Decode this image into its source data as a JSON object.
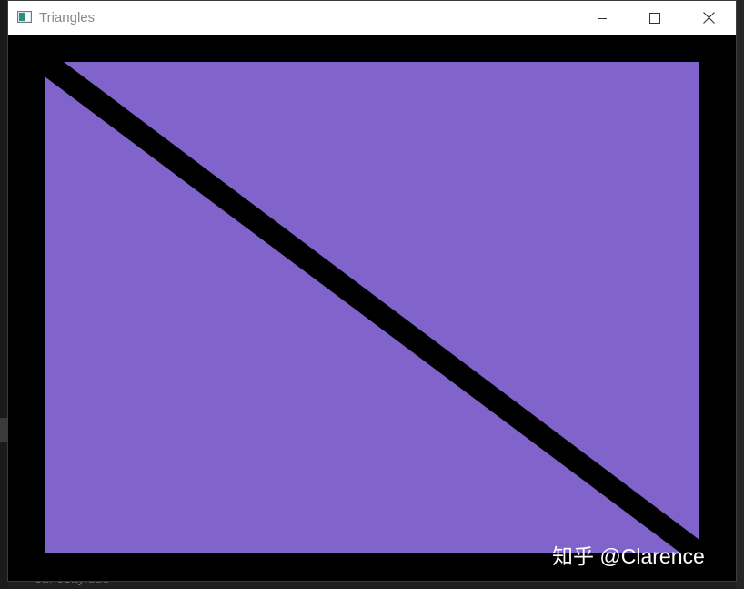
{
  "window": {
    "title": "Triangles",
    "icon": "app-window-icon",
    "controls": [
      "minimize-icon",
      "maximize-icon",
      "close-icon"
    ]
  },
  "scene": {
    "background_color": "#000000",
    "shapes": [
      {
        "name": "triangle-upper-right",
        "color": "#8064CB"
      },
      {
        "name": "triangle-lower-left",
        "color": "#8064CB"
      }
    ]
  },
  "background": {
    "file_label": "curiosity.dds"
  },
  "watermark": {
    "text": "知乎 @Clarence"
  }
}
